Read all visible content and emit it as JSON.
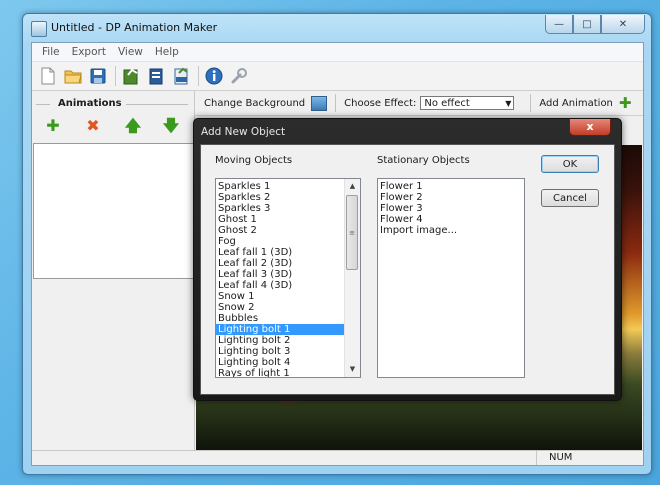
{
  "window": {
    "title": "Untitled - DP Animation Maker",
    "controls": [
      "minimize-icon",
      "maximize-icon",
      "close-icon"
    ]
  },
  "menu": [
    "File",
    "Export",
    "View",
    "Help"
  ],
  "toolbar": {
    "icons": [
      "new-file-icon",
      "open-folder-icon",
      "save-icon",
      "export-gif-icon",
      "export-video-icon",
      "export-exe-icon",
      "info-icon",
      "settings-wrench-icon"
    ]
  },
  "animations_panel": {
    "title": "Animations",
    "buttons": [
      "add-icon",
      "delete-icon",
      "move-up-icon",
      "move-down-icon"
    ]
  },
  "top_strip": {
    "change_background": "Change Background",
    "choose_effect_label": "Choose Effect:",
    "effect_value": "No effect",
    "add_animation": "Add Animation"
  },
  "status": {
    "num": "NUM"
  },
  "dialog": {
    "title": "Add New Object",
    "close": "x",
    "moving_label": "Moving Objects",
    "stationary_label": "Stationary Objects",
    "moving_items": [
      "Sparkles 1",
      "Sparkles 2",
      "Sparkles 3",
      "Ghost 1",
      "Ghost 2",
      "Fog",
      "Leaf fall 1 (3D)",
      "Leaf fall 2 (3D)",
      "Leaf fall 3 (3D)",
      "Leaf fall 4 (3D)",
      "Snow 1",
      "Snow 2",
      "Bubbles",
      "Lighting bolt 1",
      "Lighting bolt 2",
      "Lighting bolt 3",
      "Lighting bolt 4",
      "Rays of light 1"
    ],
    "moving_selected_index": 13,
    "stationary_items": [
      "Flower 1",
      "Flower 2",
      "Flower 3",
      "Flower 4",
      "Import image..."
    ],
    "ok": "OK",
    "cancel": "Cancel"
  }
}
